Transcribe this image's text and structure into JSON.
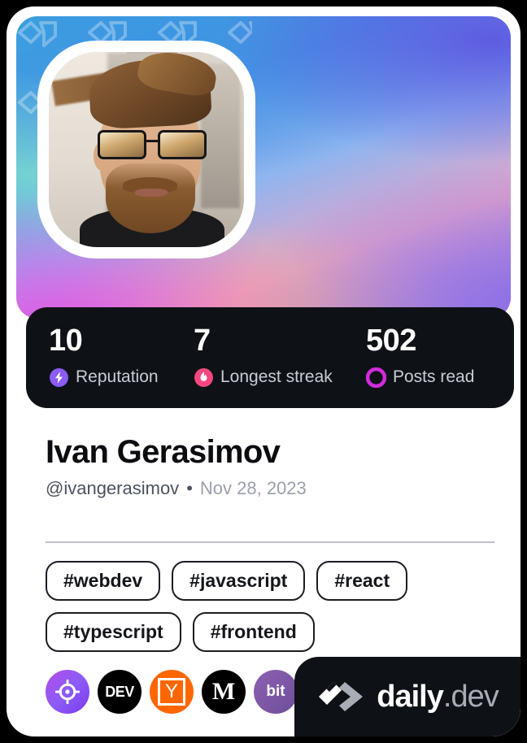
{
  "card": {
    "type": "devcard",
    "background_color": "#ffffff",
    "page_background": "#000000"
  },
  "cover": {
    "pattern": "daily-dev-chevron-watermark",
    "gradient_colors": [
      "#3aa7dc",
      "#4f8fe8",
      "#78dccd",
      "#e4a6c9",
      "#fab28c",
      "#8c6ee6",
      "#5c56e0"
    ]
  },
  "avatar": {
    "alt": "Profile photo of a bearded man wearing mirrored sunglasses",
    "frame_color": "#ffffff"
  },
  "stats": {
    "background_color": "#0e1217",
    "items": [
      {
        "value": "10",
        "label": "Reputation",
        "icon": "lightning-bolt-icon",
        "color": "#8b5cf6"
      },
      {
        "value": "7",
        "label": "Longest streak",
        "icon": "flame-icon",
        "color": "#f5477f"
      },
      {
        "value": "502",
        "label": "Posts read",
        "icon": "eye-ring-icon",
        "color": "#d12bdb"
      }
    ]
  },
  "identity": {
    "name": "Ivan Gerasimov",
    "handle": "@ivangerasimov",
    "separator": "•",
    "date": "Nov 28, 2023"
  },
  "tags": [
    {
      "label": "#webdev"
    },
    {
      "label": "#javascript"
    },
    {
      "label": "#react"
    },
    {
      "label": "#typescript"
    },
    {
      "label": "#frontend"
    }
  ],
  "socials": [
    {
      "name": "target",
      "label": ""
    },
    {
      "name": "dev",
      "label": "DEV"
    },
    {
      "name": "ycombinator",
      "label": "Y"
    },
    {
      "name": "medium",
      "label": "M"
    },
    {
      "name": "bit",
      "label": "bit"
    }
  ],
  "brand": {
    "name": "daily",
    "suffix": ".dev",
    "background_color": "#0e1217"
  }
}
